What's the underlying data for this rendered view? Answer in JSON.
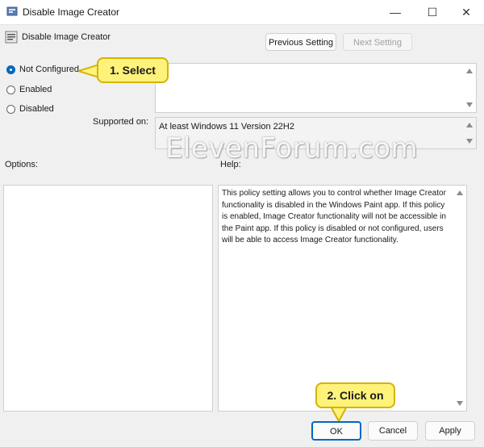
{
  "window": {
    "title": "Disable Image Creator",
    "minimize_glyph": "—",
    "maximize_glyph": "☐",
    "close_glyph": "✕"
  },
  "header": {
    "policy_name": "Disable Image Creator"
  },
  "nav": {
    "previous_label": "Previous Setting",
    "next_label": "Next Setting"
  },
  "state_options": [
    {
      "label": "Not Configured",
      "selected": true
    },
    {
      "label": "Enabled",
      "selected": false
    },
    {
      "label": "Disabled",
      "selected": false
    }
  ],
  "comment": {
    "value": ""
  },
  "supported_on": {
    "label": "Supported on:",
    "value": "At least Windows 11 Version 22H2"
  },
  "options": {
    "label": "Options:"
  },
  "help": {
    "label": "Help:",
    "text": "This policy setting allows you to control whether Image Creator functionality is disabled in the Windows Paint app. If this policy is enabled, Image Creator functionality will not be accessible in the Paint app. If this policy is disabled or not configured, users will be able to access Image Creator functionality."
  },
  "footer": {
    "ok_label": "OK",
    "cancel_label": "Cancel",
    "apply_label": "Apply"
  },
  "annotations": {
    "step1": "1. Select",
    "step2": "2. Click on"
  },
  "watermark": "ElevenForum.com",
  "colors": {
    "accent": "#0067c0",
    "callout_fill": "#fff27a",
    "callout_border": "#d4b400"
  }
}
